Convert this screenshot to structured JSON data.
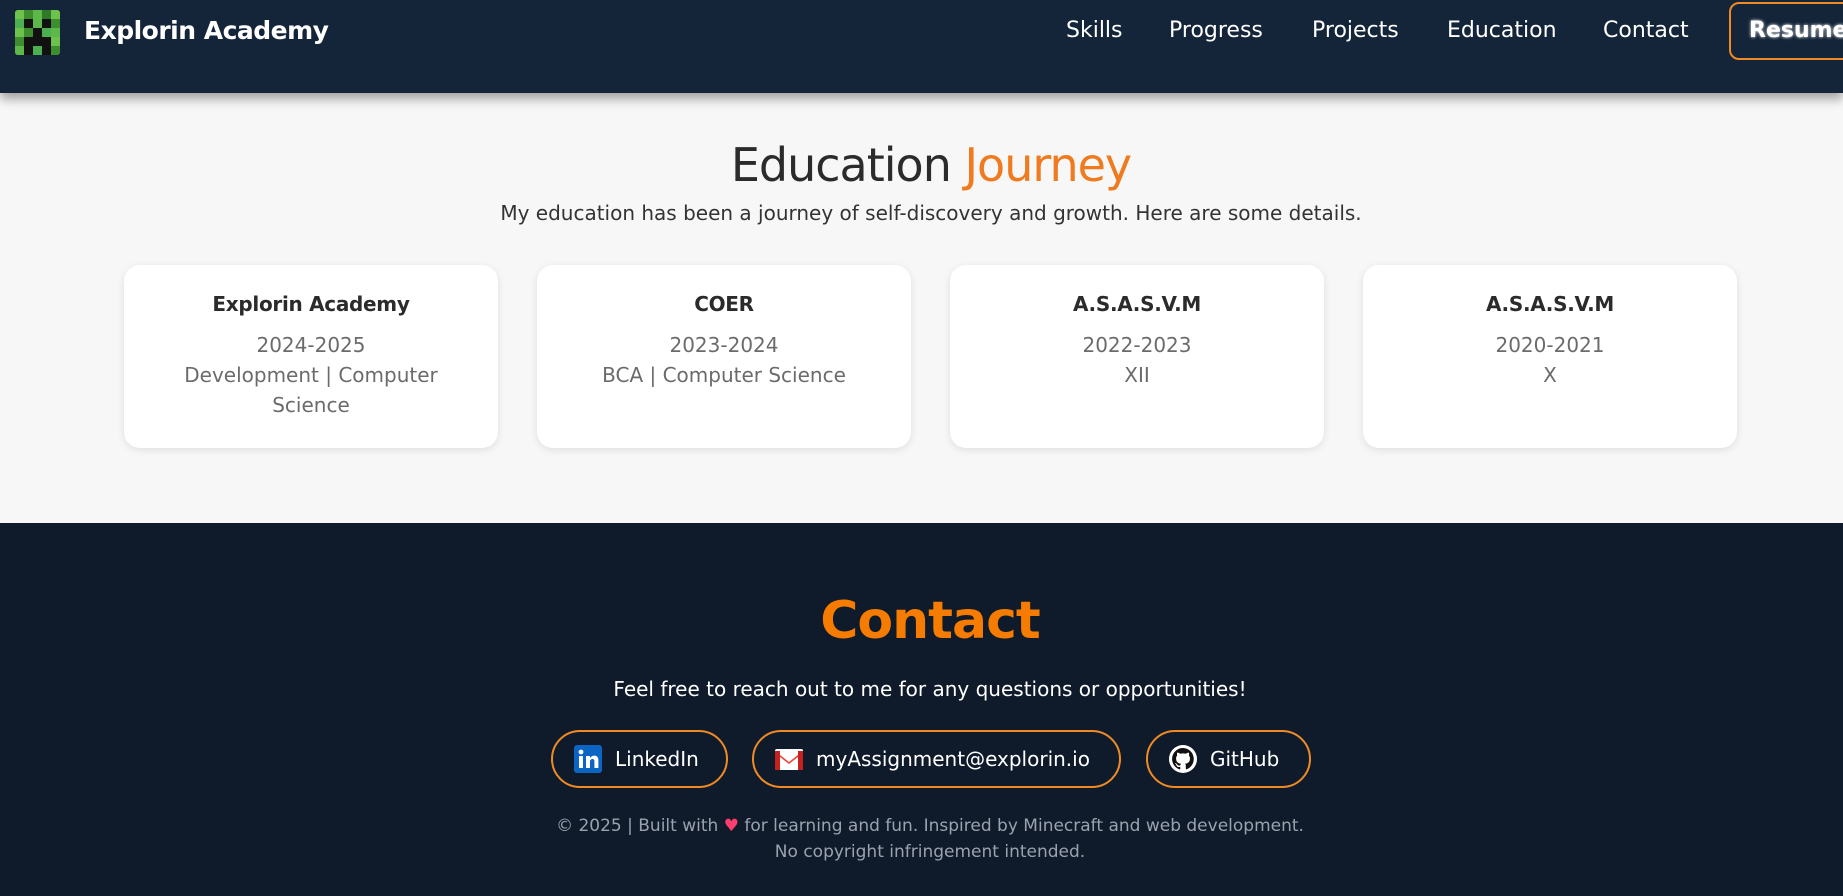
{
  "header": {
    "brand": "Explorin Academy",
    "logo_icon": "creeper-icon",
    "nav": [
      {
        "label": "Skills"
      },
      {
        "label": "Progress"
      },
      {
        "label": "Projects"
      },
      {
        "label": "Education"
      },
      {
        "label": "Contact"
      }
    ],
    "resume_label": "Resume"
  },
  "education": {
    "title_main": "Education",
    "title_accent": "Journey",
    "subtitle": "My education has been a journey of self-discovery and growth. Here are some details.",
    "cards": [
      {
        "name": "Explorin Academy",
        "year": "2024-2025",
        "detail": "Development | Computer Science"
      },
      {
        "name": "COER",
        "year": "2023-2024",
        "detail": "BCA | Computer Science"
      },
      {
        "name": "A.S.A.S.V.M",
        "year": "2022-2023",
        "detail": "XII"
      },
      {
        "name": "A.S.A.S.V.M",
        "year": "2020-2021",
        "detail": "X"
      }
    ]
  },
  "contact": {
    "title": "Contact",
    "subtitle": "Feel free to reach out to me for any questions or opportunities!",
    "links": [
      {
        "label": "LinkedIn",
        "icon": "linkedin-icon"
      },
      {
        "label": "myAssignment@explorin.io",
        "icon": "gmail-icon"
      },
      {
        "label": "GitHub",
        "icon": "github-icon"
      }
    ],
    "footer_prefix": "© 2025 | Built with",
    "footer_heart": "♥",
    "footer_suffix": "for learning and fun. Inspired by Minecraft and web development.",
    "footer_line2": "No copyright infringement intended."
  },
  "colors": {
    "nav_bg": "#14253a",
    "page_bg": "#0f1b2b",
    "accent": "#f57c00",
    "section_bg": "#f7f7f7"
  }
}
